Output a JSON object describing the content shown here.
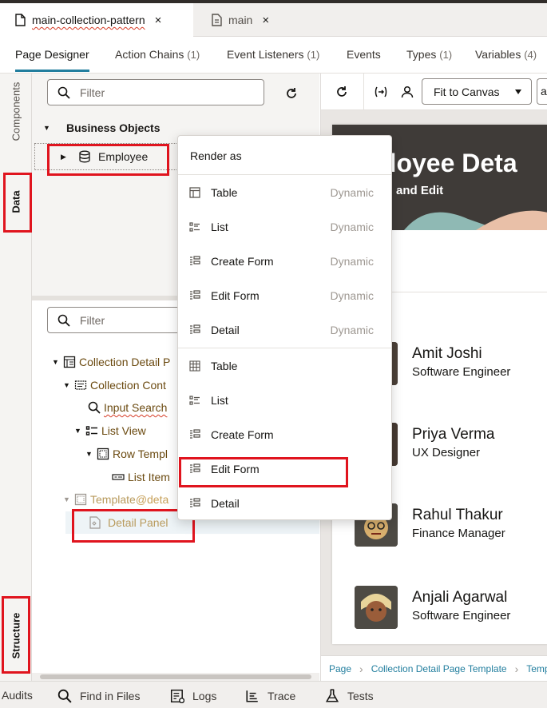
{
  "editor_tabs": [
    {
      "label": "main-collection-pattern",
      "close": "×"
    },
    {
      "label": "main",
      "close": "×"
    }
  ],
  "designer_tabs": [
    {
      "label": "Page Designer",
      "count": ""
    },
    {
      "label": "Action Chains",
      "count": "(1)"
    },
    {
      "label": "Event Listeners",
      "count": "(1)"
    },
    {
      "label": "Events",
      "count": ""
    },
    {
      "label": "Types",
      "count": "(1)"
    },
    {
      "label": "Variables",
      "count": "(4)"
    }
  ],
  "side_tabs": {
    "components": "Components",
    "data": "Data",
    "structure": "Structure"
  },
  "data_panel": {
    "filter_placeholder": "Filter",
    "business_objects": "Business Objects",
    "employee": "Employee"
  },
  "structure_panel": {
    "filter_placeholder": "Filter",
    "nodes": [
      "Collection Detail P",
      "Collection Cont",
      "Input Search",
      "List View",
      "Row Templ",
      "List Item",
      "Template",
      "@deta",
      "Detail Panel"
    ]
  },
  "context_menu": {
    "header": "Render as",
    "dynamic_items": [
      {
        "label": "Table",
        "tag": "Dynamic",
        "icon": "table-icon"
      },
      {
        "label": "List",
        "tag": "Dynamic",
        "icon": "list-icon"
      },
      {
        "label": "Create Form",
        "tag": "Dynamic",
        "icon": "form-icon"
      },
      {
        "label": "Edit Form",
        "tag": "Dynamic",
        "icon": "form-icon"
      },
      {
        "label": "Detail",
        "tag": "Dynamic",
        "icon": "form-icon"
      }
    ],
    "static_items": [
      {
        "label": "Table",
        "icon": "table-icon"
      },
      {
        "label": "List",
        "icon": "list-icon"
      },
      {
        "label": "Create Form",
        "icon": "form-icon"
      },
      {
        "label": "Edit Form",
        "icon": "form-icon"
      },
      {
        "label": "Detail",
        "icon": "form-icon"
      }
    ]
  },
  "canvas": {
    "fit_label": "Fit to Canvas",
    "extra_label": "a",
    "hero_title": "ployee Deta",
    "hero_sub": "and Edit",
    "employees": [
      {
        "name": "Amit Joshi",
        "role": "Software Engineer"
      },
      {
        "name": "Priya Verma",
        "role": "UX Designer"
      },
      {
        "name": "Rahul Thakur",
        "role": "Finance Manager"
      },
      {
        "name": "Anjali Agarwal",
        "role": "Software Engineer"
      }
    ]
  },
  "breadcrumb": [
    "Page",
    "Collection Detail Page Template",
    "Templ"
  ],
  "bottom_bar": [
    {
      "label": "Audits"
    },
    {
      "label": "Find in Files"
    },
    {
      "label": "Logs"
    },
    {
      "label": "Trace"
    },
    {
      "label": "Tests"
    }
  ],
  "colors": {
    "accent": "#227e9e",
    "highlight": "#e0141e",
    "folder_text": "#6b4a10"
  }
}
